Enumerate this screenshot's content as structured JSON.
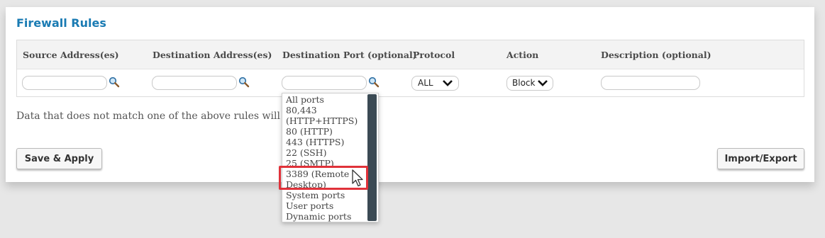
{
  "panel": {
    "title": "Firewall Rules",
    "headers": {
      "source": "Source Address(es)",
      "destination": "Destination Address(es)",
      "port": "Destination Port (optional)",
      "protocol": "Protocol",
      "action": "Action",
      "description": "Description (optional)"
    },
    "protocol_value": "ALL",
    "action_value": "Block",
    "note": "Data that does not match one of the above rules will b",
    "save_button": "Save & Apply",
    "import_button": "Import/Export"
  },
  "port_dropdown": {
    "options": [
      "All ports",
      "80,443",
      "(HTTP+HTTPS)",
      "80 (HTTP)",
      "443 (HTTPS)",
      "22 (SSH)",
      "25 (SMTP)",
      "3389 (Remote",
      "Desktop)",
      "System ports",
      "User ports",
      "Dynamic ports"
    ],
    "highlighted": "3389 (Remote Desktop)"
  },
  "colors": {
    "title": "#1a7bb3",
    "highlight": "#e0323a",
    "scrollbar": "#3b4a54"
  },
  "icons": [
    "search-icon",
    "chevron-down-icon",
    "mouse-pointer-icon"
  ]
}
